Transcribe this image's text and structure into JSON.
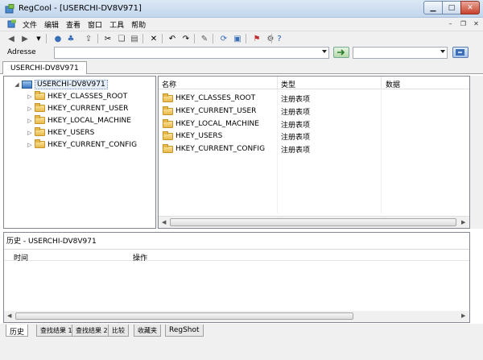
{
  "window": {
    "title": "RegCool - [USERCHI-DV8V971]"
  },
  "menu": [
    "文件",
    "编辑",
    "查看",
    "窗口",
    "工具",
    "帮助"
  ],
  "address": {
    "label": "Adresse",
    "value": "",
    "search_value": ""
  },
  "doc_tab": {
    "label": "USERCHI-DV8V971"
  },
  "tree": {
    "root": "USERCHI-DV8V971",
    "nodes": [
      "HKEY_CLASSES_ROOT",
      "HKEY_CURRENT_USER",
      "HKEY_LOCAL_MACHINE",
      "HKEY_USERS",
      "HKEY_CURRENT_CONFIG"
    ]
  },
  "list": {
    "columns": {
      "name": "名称",
      "type": "类型",
      "data": "数据"
    },
    "rows": [
      {
        "name": "HKEY_CLASSES_ROOT",
        "type": "注册表项"
      },
      {
        "name": "HKEY_CURRENT_USER",
        "type": "注册表项"
      },
      {
        "name": "HKEY_LOCAL_MACHINE",
        "type": "注册表项"
      },
      {
        "name": "HKEY_USERS",
        "type": "注册表项"
      },
      {
        "name": "HKEY_CURRENT_CONFIG",
        "type": "注册表项"
      }
    ]
  },
  "history": {
    "title": "历史 - USERCHI-DV8V971",
    "columns": {
      "time": "时间",
      "action": "操作"
    }
  },
  "bottom_tabs": [
    "历史",
    "查找结果 1",
    "查找结果 2",
    "比较",
    "收藏夹",
    "RegShot"
  ]
}
